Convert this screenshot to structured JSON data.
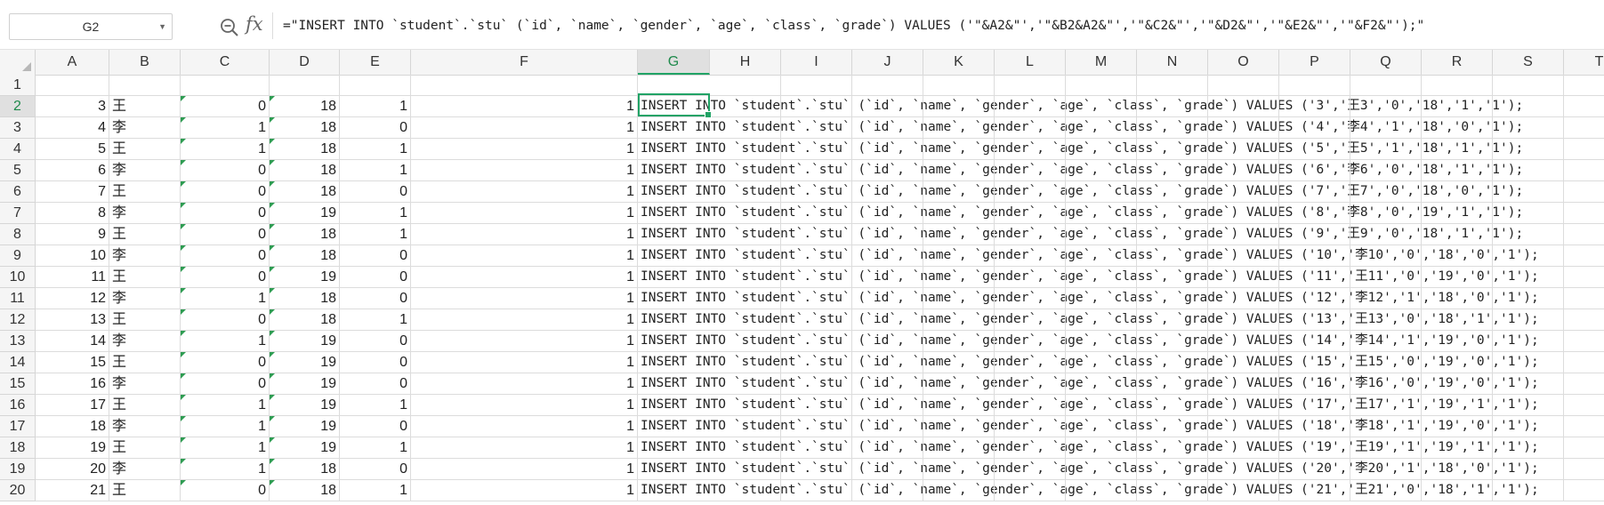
{
  "formula_bar": {
    "name_box": "G2",
    "fx_label": "fx",
    "formula": "=\"INSERT INTO `student`.`stu` (`id`, `name`, `gender`, `age`, `class`, `grade`) VALUES ('\"&A2&\"','\"&B2&A2&\"','\"&C2&\"','\"&D2&\"','\"&E2&\"','\"&F2&\"');\""
  },
  "columns": [
    "A",
    "B",
    "C",
    "D",
    "E",
    "F",
    "G",
    "H",
    "I",
    "J",
    "K",
    "L",
    "M",
    "N",
    "O",
    "P",
    "Q",
    "R",
    "S",
    "T"
  ],
  "selected_column": "G",
  "selected_row": "2",
  "rows": [
    {
      "n": "1",
      "A": "",
      "B": "",
      "C": "",
      "D": "",
      "E": "",
      "F": "",
      "G": ""
    },
    {
      "n": "2",
      "A": "3",
      "B": "王",
      "C": "0",
      "D": "18",
      "E": "1",
      "F": "1",
      "G": "INSERT INTO `student`.`stu` (`id`, `name`, `gender`, `age`, `class`, `grade`) VALUES ('3','王3','0','18','1','1');"
    },
    {
      "n": "3",
      "A": "4",
      "B": "李",
      "C": "1",
      "D": "18",
      "E": "0",
      "F": "1",
      "G": "INSERT INTO `student`.`stu` (`id`, `name`, `gender`, `age`, `class`, `grade`) VALUES ('4','李4','1','18','0','1');"
    },
    {
      "n": "4",
      "A": "5",
      "B": "王",
      "C": "1",
      "D": "18",
      "E": "1",
      "F": "1",
      "G": "INSERT INTO `student`.`stu` (`id`, `name`, `gender`, `age`, `class`, `grade`) VALUES ('5','王5','1','18','1','1');"
    },
    {
      "n": "5",
      "A": "6",
      "B": "李",
      "C": "0",
      "D": "18",
      "E": "1",
      "F": "1",
      "G": "INSERT INTO `student`.`stu` (`id`, `name`, `gender`, `age`, `class`, `grade`) VALUES ('6','李6','0','18','1','1');"
    },
    {
      "n": "6",
      "A": "7",
      "B": "王",
      "C": "0",
      "D": "18",
      "E": "0",
      "F": "1",
      "G": "INSERT INTO `student`.`stu` (`id`, `name`, `gender`, `age`, `class`, `grade`) VALUES ('7','王7','0','18','0','1');"
    },
    {
      "n": "7",
      "A": "8",
      "B": "李",
      "C": "0",
      "D": "19",
      "E": "1",
      "F": "1",
      "G": "INSERT INTO `student`.`stu` (`id`, `name`, `gender`, `age`, `class`, `grade`) VALUES ('8','李8','0','19','1','1');"
    },
    {
      "n": "8",
      "A": "9",
      "B": "王",
      "C": "0",
      "D": "18",
      "E": "1",
      "F": "1",
      "G": "INSERT INTO `student`.`stu` (`id`, `name`, `gender`, `age`, `class`, `grade`) VALUES ('9','王9','0','18','1','1');"
    },
    {
      "n": "9",
      "A": "10",
      "B": "李",
      "C": "0",
      "D": "18",
      "E": "0",
      "F": "1",
      "G": "INSERT INTO `student`.`stu` (`id`, `name`, `gender`, `age`, `class`, `grade`) VALUES ('10','李10','0','18','0','1');"
    },
    {
      "n": "10",
      "A": "11",
      "B": "王",
      "C": "0",
      "D": "19",
      "E": "0",
      "F": "1",
      "G": "INSERT INTO `student`.`stu` (`id`, `name`, `gender`, `age`, `class`, `grade`) VALUES ('11','王11','0','19','0','1');"
    },
    {
      "n": "11",
      "A": "12",
      "B": "李",
      "C": "1",
      "D": "18",
      "E": "0",
      "F": "1",
      "G": "INSERT INTO `student`.`stu` (`id`, `name`, `gender`, `age`, `class`, `grade`) VALUES ('12','李12','1','18','0','1');"
    },
    {
      "n": "12",
      "A": "13",
      "B": "王",
      "C": "0",
      "D": "18",
      "E": "1",
      "F": "1",
      "G": "INSERT INTO `student`.`stu` (`id`, `name`, `gender`, `age`, `class`, `grade`) VALUES ('13','王13','0','18','1','1');"
    },
    {
      "n": "13",
      "A": "14",
      "B": "李",
      "C": "1",
      "D": "19",
      "E": "0",
      "F": "1",
      "G": "INSERT INTO `student`.`stu` (`id`, `name`, `gender`, `age`, `class`, `grade`) VALUES ('14','李14','1','19','0','1');"
    },
    {
      "n": "14",
      "A": "15",
      "B": "王",
      "C": "0",
      "D": "19",
      "E": "0",
      "F": "1",
      "G": "INSERT INTO `student`.`stu` (`id`, `name`, `gender`, `age`, `class`, `grade`) VALUES ('15','王15','0','19','0','1');"
    },
    {
      "n": "15",
      "A": "16",
      "B": "李",
      "C": "0",
      "D": "19",
      "E": "0",
      "F": "1",
      "G": "INSERT INTO `student`.`stu` (`id`, `name`, `gender`, `age`, `class`, `grade`) VALUES ('16','李16','0','19','0','1');"
    },
    {
      "n": "16",
      "A": "17",
      "B": "王",
      "C": "1",
      "D": "19",
      "E": "1",
      "F": "1",
      "G": "INSERT INTO `student`.`stu` (`id`, `name`, `gender`, `age`, `class`, `grade`) VALUES ('17','王17','1','19','1','1');"
    },
    {
      "n": "17",
      "A": "18",
      "B": "李",
      "C": "1",
      "D": "19",
      "E": "0",
      "F": "1",
      "G": "INSERT INTO `student`.`stu` (`id`, `name`, `gender`, `age`, `class`, `grade`) VALUES ('18','李18','1','19','0','1');"
    },
    {
      "n": "18",
      "A": "19",
      "B": "王",
      "C": "1",
      "D": "19",
      "E": "1",
      "F": "1",
      "G": "INSERT INTO `student`.`stu` (`id`, `name`, `gender`, `age`, `class`, `grade`) VALUES ('19','王19','1','19','1','1');"
    },
    {
      "n": "19",
      "A": "20",
      "B": "李",
      "C": "1",
      "D": "18",
      "E": "0",
      "F": "1",
      "G": "INSERT INTO `student`.`stu` (`id`, `name`, `gender`, `age`, `class`, `grade`) VALUES ('20','李20','1','18','0','1');"
    },
    {
      "n": "20",
      "A": "21",
      "B": "王",
      "C": "0",
      "D": "18",
      "E": "1",
      "F": "1",
      "G": "INSERT INTO `student`.`stu` (`id`, `name`, `gender`, `age`, `class`, `grade`) VALUES ('21','王21','0','18','1','1');"
    }
  ],
  "colors": {
    "accent": "#21a366",
    "error_triangle": "#2e9c52"
  }
}
